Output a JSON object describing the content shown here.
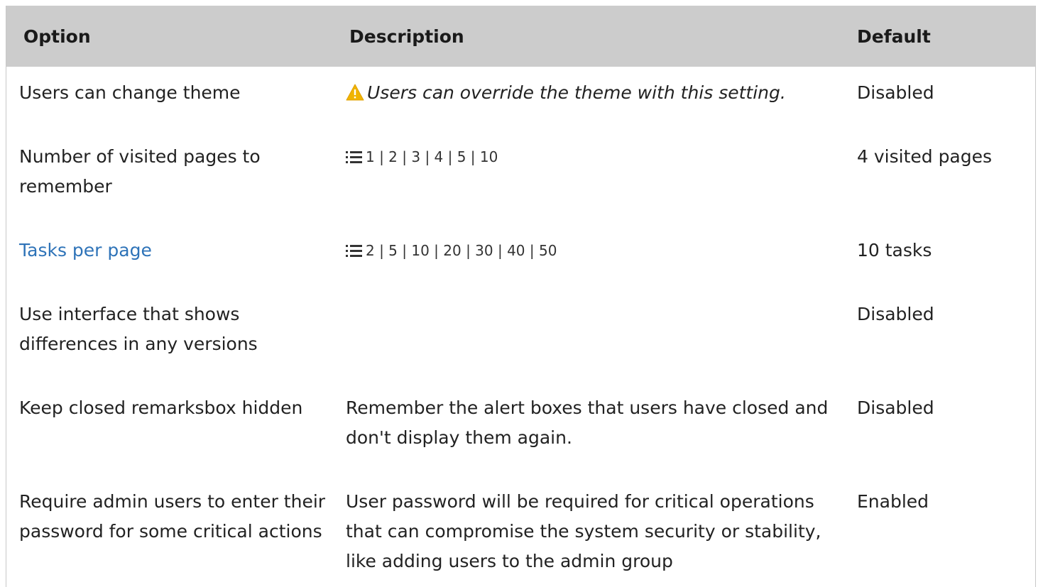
{
  "table": {
    "headers": {
      "option": "Option",
      "description": "Description",
      "default": "Default"
    },
    "rows": [
      {
        "option": "Users can change theme",
        "description": "Users can override the theme with this setting.",
        "description_icon": "warning-icon",
        "default": "Disabled"
      },
      {
        "option": "Number of visited pages to remember",
        "description": "1 | 2 | 3 | 4 | 5 | 10",
        "description_icon": "list-icon",
        "default": "4 visited pages"
      },
      {
        "option": "Tasks per page",
        "option_is_link": true,
        "description": "2 | 5 | 10 | 20 | 30 | 40 | 50",
        "description_icon": "list-icon",
        "default": "10 tasks"
      },
      {
        "option": "Use interface that shows differences in any versions",
        "description": "",
        "default": "Disabled"
      },
      {
        "option": "Keep closed remarksbox hidden",
        "description": "Remember the alert boxes that users have closed and don't display them again.",
        "default": "Disabled"
      },
      {
        "option": "Require admin users to enter their password for some critical actions",
        "description": "User password will be required for critical operations that can compromise the system security or stability, like adding users to the admin group",
        "default": "Enabled"
      }
    ]
  },
  "colors": {
    "header_bg": "#cccccc",
    "link": "#2e73b8",
    "warning": "#f0b400"
  }
}
